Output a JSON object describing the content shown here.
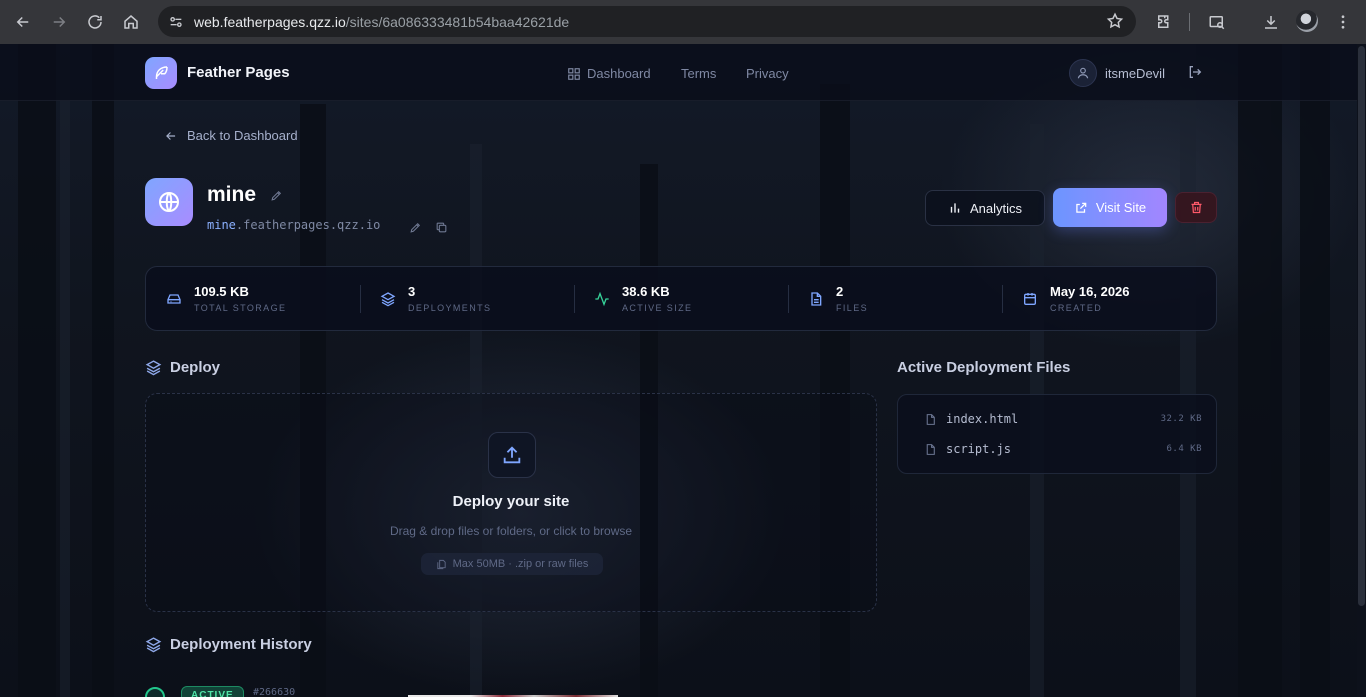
{
  "browser": {
    "url_host": "web.featherpages.qzz.io",
    "url_path": "/sites/6a086333481b54baa42621de"
  },
  "nav": {
    "brand": "Feather Pages",
    "links": {
      "dashboard": "Dashboard",
      "terms": "Terms",
      "privacy": "Privacy"
    },
    "username": "itsmeDevil"
  },
  "back_label": "Back to Dashboard",
  "site": {
    "name": "mine",
    "subdomain": "mine",
    "domain_suffix": ".featherpages.qzz.io"
  },
  "actions": {
    "analytics": "Analytics",
    "visit": "Visit Site"
  },
  "stats": [
    {
      "icon": "drive-icon",
      "value": "109.5 KB",
      "label": "TOTAL STORAGE"
    },
    {
      "icon": "layers-icon",
      "value": "3",
      "label": "DEPLOYMENTS"
    },
    {
      "icon": "activity-icon",
      "value": "38.6 KB",
      "label": "ACTIVE SIZE"
    },
    {
      "icon": "file-icon",
      "value": "2",
      "label": "FILES"
    },
    {
      "icon": "calendar-icon",
      "value": "May 16, 2026",
      "label": "CREATED"
    }
  ],
  "deploy": {
    "title": "Deploy",
    "dropzone_title": "Deploy your site",
    "dropzone_subtitle": "Drag & drop files or folders, or click to browse",
    "limit_note": "Max 50MB · .zip or raw files"
  },
  "active_files": {
    "title": "Active Deployment Files",
    "files": [
      {
        "name": "index.html",
        "size": "32.2 KB"
      },
      {
        "name": "script.js",
        "size": "6.4 KB"
      }
    ]
  },
  "history": {
    "title": "Deployment History",
    "first": {
      "status": "ACTIVE",
      "id": "#266630"
    }
  },
  "colors": {
    "accent": "#7fa6ff",
    "accent2": "#a286ff",
    "success": "#36d399",
    "danger": "#ff5a6a"
  }
}
